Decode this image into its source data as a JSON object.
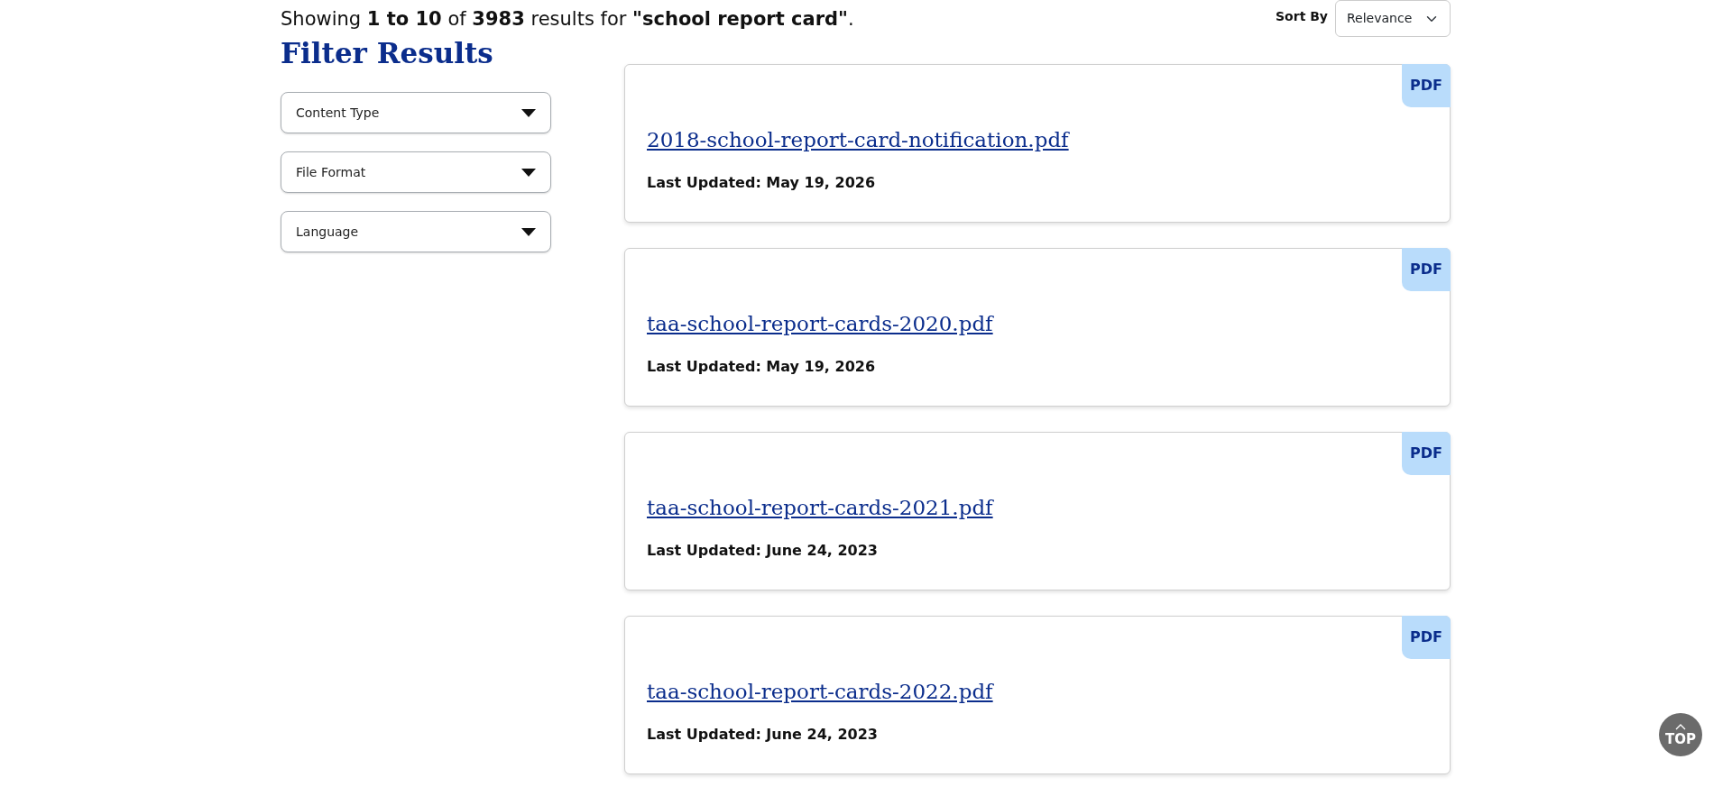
{
  "summary": "Showing **1 to 10** of **3983** results for **\"school report card\"**.",
  "sort": {
    "label": "Sort By",
    "value": "Relevance"
  },
  "filters": {
    "title": "Filter Results",
    "dropdowns": [
      {
        "label": "Content Type"
      },
      {
        "label": "File Format"
      },
      {
        "label": "Language"
      }
    ]
  },
  "results": [
    {
      "badge": "PDF",
      "title": "2018-school-report-card-notification.pdf",
      "updated": "Last Updated: May 19, 2026"
    },
    {
      "badge": "PDF",
      "title": "taa-school-report-cards-2020.pdf",
      "updated": "Last Updated: May 19, 2026"
    },
    {
      "badge": "PDF",
      "title": "taa-school-report-cards-2021.pdf",
      "updated": "Last Updated: June 24, 2023"
    },
    {
      "badge": "PDF",
      "title": "taa-school-report-cards-2022.pdf",
      "updated": "Last Updated: June 24, 2023"
    }
  ],
  "back_to_top": "TOP"
}
